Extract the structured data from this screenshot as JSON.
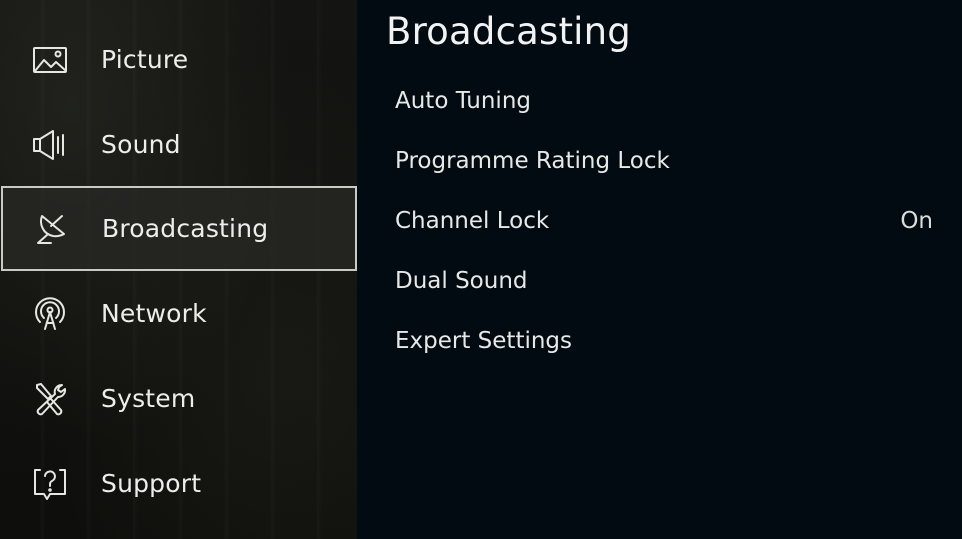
{
  "sidebar": {
    "items": [
      {
        "label": "Picture",
        "icon": "picture-icon",
        "selected": false
      },
      {
        "label": "Sound",
        "icon": "speaker-icon",
        "selected": false
      },
      {
        "label": "Broadcasting",
        "icon": "satellite-dish-icon",
        "selected": true
      },
      {
        "label": "Network",
        "icon": "antenna-signal-icon",
        "selected": false
      },
      {
        "label": "System",
        "icon": "wrench-screwdriver-icon",
        "selected": false
      },
      {
        "label": "Support",
        "icon": "help-bubble-icon",
        "selected": false
      }
    ]
  },
  "content": {
    "title": "Broadcasting",
    "options": [
      {
        "label": "Auto Tuning",
        "value": ""
      },
      {
        "label": "Programme Rating Lock",
        "value": ""
      },
      {
        "label": "Channel Lock",
        "value": "On"
      },
      {
        "label": "Dual Sound",
        "value": ""
      },
      {
        "label": "Expert Settings",
        "value": ""
      }
    ]
  },
  "colors": {
    "selection_border": "#c9c9c6",
    "content_background": "#020b12",
    "text": "#ededeb"
  }
}
